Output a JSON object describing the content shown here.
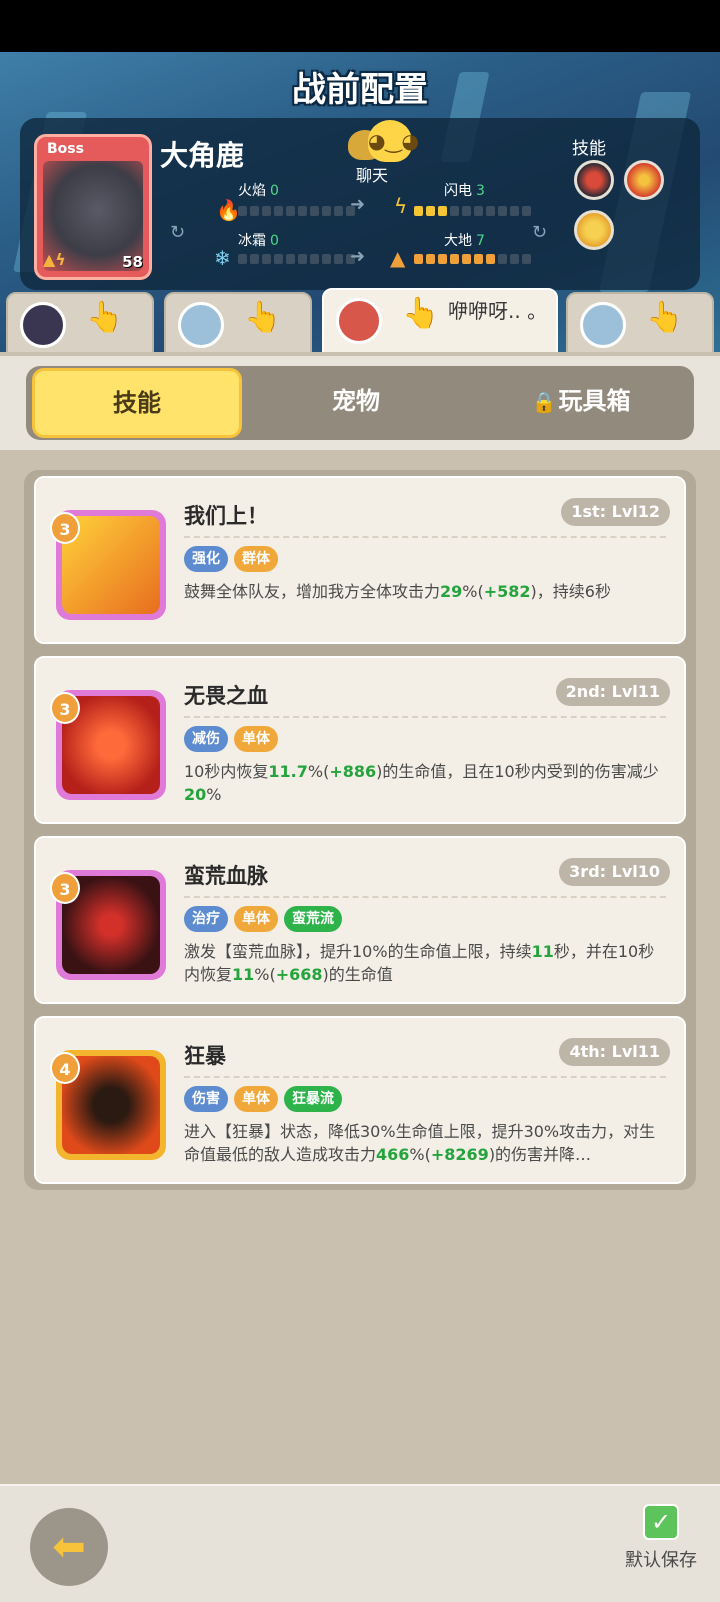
{
  "header": {
    "title": "战前配置",
    "boss": {
      "tag": "Boss",
      "name": "大角鹿",
      "level": "58"
    },
    "chat_label": "聊天",
    "stats": {
      "fire": {
        "label": "火焰",
        "value": "0",
        "filled": 0
      },
      "lightning": {
        "label": "闪电",
        "value": "3",
        "filled": 3
      },
      "frost": {
        "label": "冰霜",
        "value": "0",
        "filled": 0
      },
      "earth": {
        "label": "大地",
        "value": "7",
        "filled": 7
      }
    },
    "skills_label": "技能"
  },
  "hero_tabs": [
    {
      "id": "hero-1",
      "speech": ""
    },
    {
      "id": "hero-2",
      "speech": ""
    },
    {
      "id": "hero-3",
      "speech": "咿咿呀.. 。",
      "active": true
    },
    {
      "id": "hero-4",
      "speech": ""
    }
  ],
  "category_tabs": {
    "skills": "技能",
    "pets": "宠物",
    "toybox": "玩具箱",
    "active": "skills"
  },
  "skills": [
    {
      "name": "我们上！",
      "rank": "1st: Lvl12",
      "badge": "3",
      "tags": [
        {
          "text": "强化",
          "color": "blue"
        },
        {
          "text": "群体",
          "color": "orange"
        }
      ],
      "desc_parts": [
        {
          "t": "鼓舞全体队友，增加我方全体攻击力"
        },
        {
          "t": "29",
          "hl": true
        },
        {
          "t": "%("
        },
        {
          "t": "+582",
          "hl": true
        },
        {
          "t": ")，持续6秒"
        }
      ]
    },
    {
      "name": "无畏之血",
      "rank": "2nd: Lvl11",
      "badge": "3",
      "tags": [
        {
          "text": "减伤",
          "color": "blue"
        },
        {
          "text": "单体",
          "color": "orange"
        }
      ],
      "desc_parts": [
        {
          "t": "10秒内恢复"
        },
        {
          "t": "11.7",
          "hl": true
        },
        {
          "t": "%("
        },
        {
          "t": "+886",
          "hl": true
        },
        {
          "t": ")的生命值，且在10秒内受到的伤害减少"
        },
        {
          "t": "20",
          "hl": true
        },
        {
          "t": "%"
        }
      ]
    },
    {
      "name": "蛮荒血脉",
      "rank": "3rd: Lvl10",
      "badge": "3",
      "tags": [
        {
          "text": "治疗",
          "color": "blue"
        },
        {
          "text": "单体",
          "color": "orange"
        },
        {
          "text": "蛮荒流",
          "color": "green"
        }
      ],
      "desc_parts": [
        {
          "t": "激发【蛮荒血脉】，提升10%的生命值上限，持续"
        },
        {
          "t": "11",
          "hl": true
        },
        {
          "t": "秒，并在10秒内恢复"
        },
        {
          "t": "11",
          "hl": true
        },
        {
          "t": "%("
        },
        {
          "t": "+668",
          "hl": true
        },
        {
          "t": ")的生命值"
        }
      ]
    },
    {
      "name": "狂暴",
      "rank": "4th: Lvl11",
      "badge": "4",
      "tags": [
        {
          "text": "伤害",
          "color": "blue"
        },
        {
          "text": "单体",
          "color": "orange"
        },
        {
          "text": "狂暴流",
          "color": "green"
        }
      ],
      "desc_parts": [
        {
          "t": "进入【狂暴】状态，降低30%生命值上限，提升30%攻击力，对生命值最低的敌人造成攻击力"
        },
        {
          "t": "466",
          "hl": true
        },
        {
          "t": "%("
        },
        {
          "t": "+8269",
          "hl": true
        },
        {
          "t": ")的伤害并降…"
        }
      ]
    }
  ],
  "bottom": {
    "save_label": "默认保存"
  },
  "colors": {
    "tab_active": "#ffe36a",
    "highlight_green": "#25a33d",
    "tag_blue": "#5c8bd0",
    "tag_orange": "#f0a83a",
    "tag_green": "#2eb24a"
  },
  "icons": {
    "fire": "flame-icon",
    "lightning": "lightning-icon",
    "frost": "snowflake-icon",
    "earth": "mountain-icon",
    "back": "back-arrow-icon",
    "save": "checkbox-icon",
    "lock": "lock-icon",
    "chat": "chat-bubble-icon"
  }
}
